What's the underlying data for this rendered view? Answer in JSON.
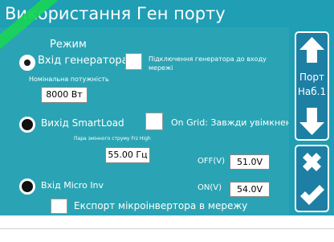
{
  "title": "Використання Ген порту",
  "mode_label": "Режим",
  "options": [
    {
      "label": "Вхід генератора",
      "selected": true
    },
    {
      "label": "Вихід SmartLoad",
      "selected": false
    },
    {
      "label": "Вхід Micro Inv",
      "selected": false
    }
  ],
  "grid_connect_label": "Підключення генератора до входу мережі",
  "grid_connect_line1": "Підключення генератора до входу",
  "grid_connect_line2": "мережі",
  "rated_power_label": "Номінальна потужність",
  "rated_power_value": "8000 Вт",
  "on_grid_label": "On Grid: Завжди увімкнено",
  "frz_label": "Пара змінного струму Frz High",
  "frz_value": "55.00 Гц",
  "off_label": "OFF(V)",
  "off_value": "51.0V",
  "on_label": "ON(V)",
  "on_value": "54.0V",
  "export_label": "Експорт мікроінвертора в мережу",
  "side": {
    "port_label": "Порт",
    "set_label": "Наб.1",
    "up_icon": "arrow-up-icon",
    "down_icon": "arrow-down-icon",
    "cancel_icon": "x-icon",
    "confirm_icon": "check-icon"
  },
  "colors": {
    "panel": "#2aa4b4",
    "button": "#1d7fa4",
    "ribbon": "#19d35a"
  }
}
